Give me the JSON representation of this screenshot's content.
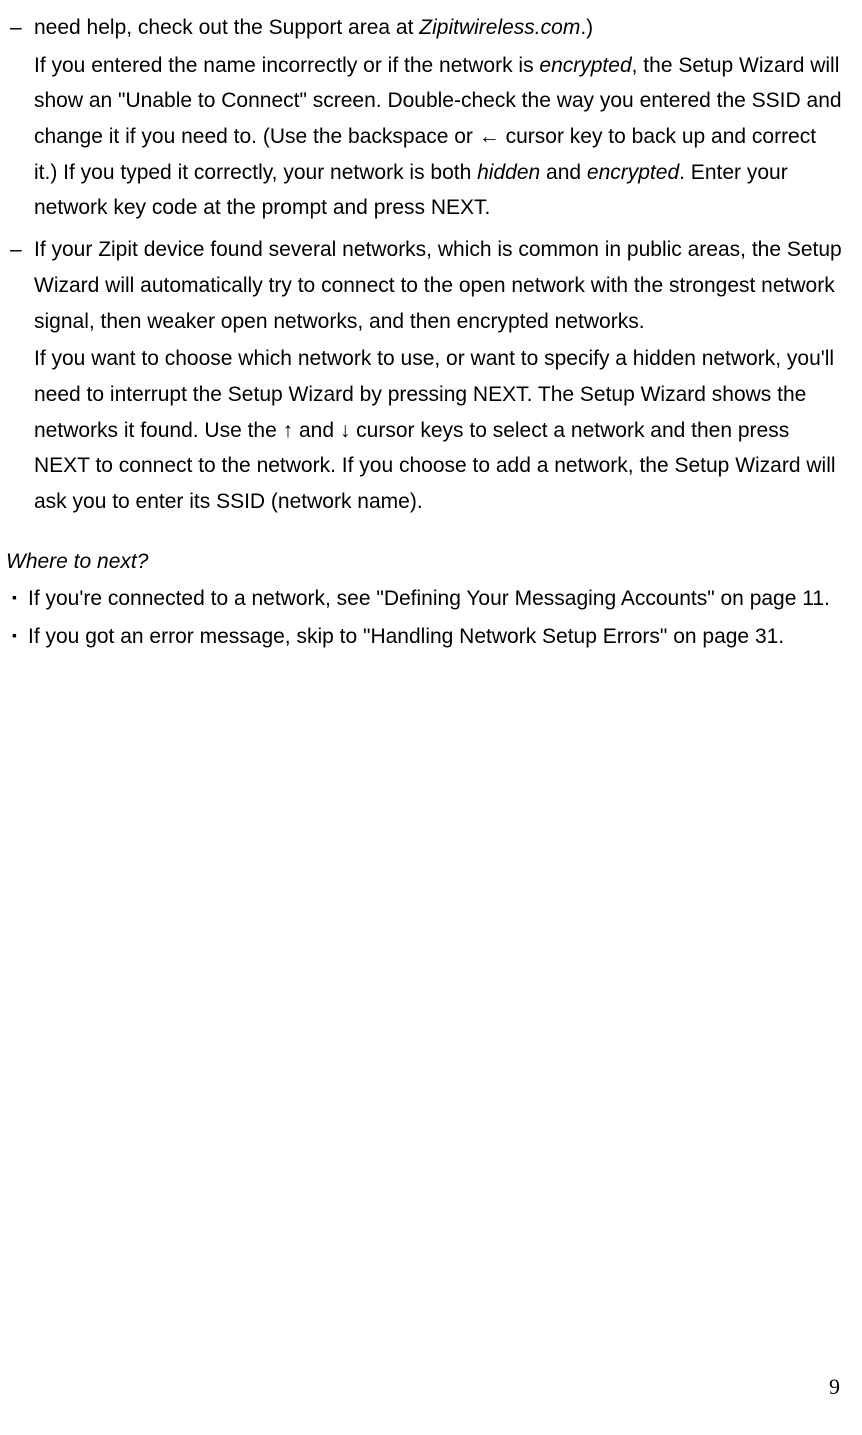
{
  "items": [
    {
      "marker": "–",
      "paragraphs": [
        {
          "segments": [
            {
              "t": "need help, check out the Support area at "
            },
            {
              "t": "Zipitwireless.com",
              "italic": true
            },
            {
              "t": ".)"
            }
          ]
        },
        {
          "segments": [
            {
              "t": "If you entered the name incorrectly or if the network is "
            },
            {
              "t": "encrypted",
              "italic": true
            },
            {
              "t": ", the Setup Wizard will show an \"Unable to Connect\" screen. Double-check the way you entered the SSID and change it if you need to.   (Use the backspace or ← cursor key to back up and correct it.)   If you typed it correctly, your network is both "
            },
            {
              "t": "hidden",
              "italic": true
            },
            {
              "t": " and "
            },
            {
              "t": "encrypted",
              "italic": true
            },
            {
              "t": ".   Enter your network key code at the prompt and press NEXT."
            }
          ]
        }
      ]
    },
    {
      "marker": "–",
      "paragraphs": [
        {
          "segments": [
            {
              "t": "If your Zipit device found several networks, which is common in public areas, the Setup Wizard will automatically try to connect to the open network with the strongest network signal, then weaker open networks, and then encrypted networks."
            }
          ]
        },
        {
          "segments": [
            {
              "t": "If you want to choose which network to use, or want to specify a hidden network, you'll need to interrupt the Setup Wizard by pressing NEXT.   The Setup Wizard shows the networks it found. Use the ↑ and ↓ cursor keys to select a network and then press NEXT to connect to the network.    If you choose to add a network, the Setup Wizard will ask you to enter its SSID (network name)."
            }
          ]
        }
      ]
    }
  ],
  "where_heading": "Where to next?",
  "where_items": [
    "If you're connected to a network, see \"Defining Your Messaging Accounts\" on page 11.",
    "If you got an error message, skip to \"Handling Network Setup Errors\" on page 31."
  ],
  "page_number": "9"
}
